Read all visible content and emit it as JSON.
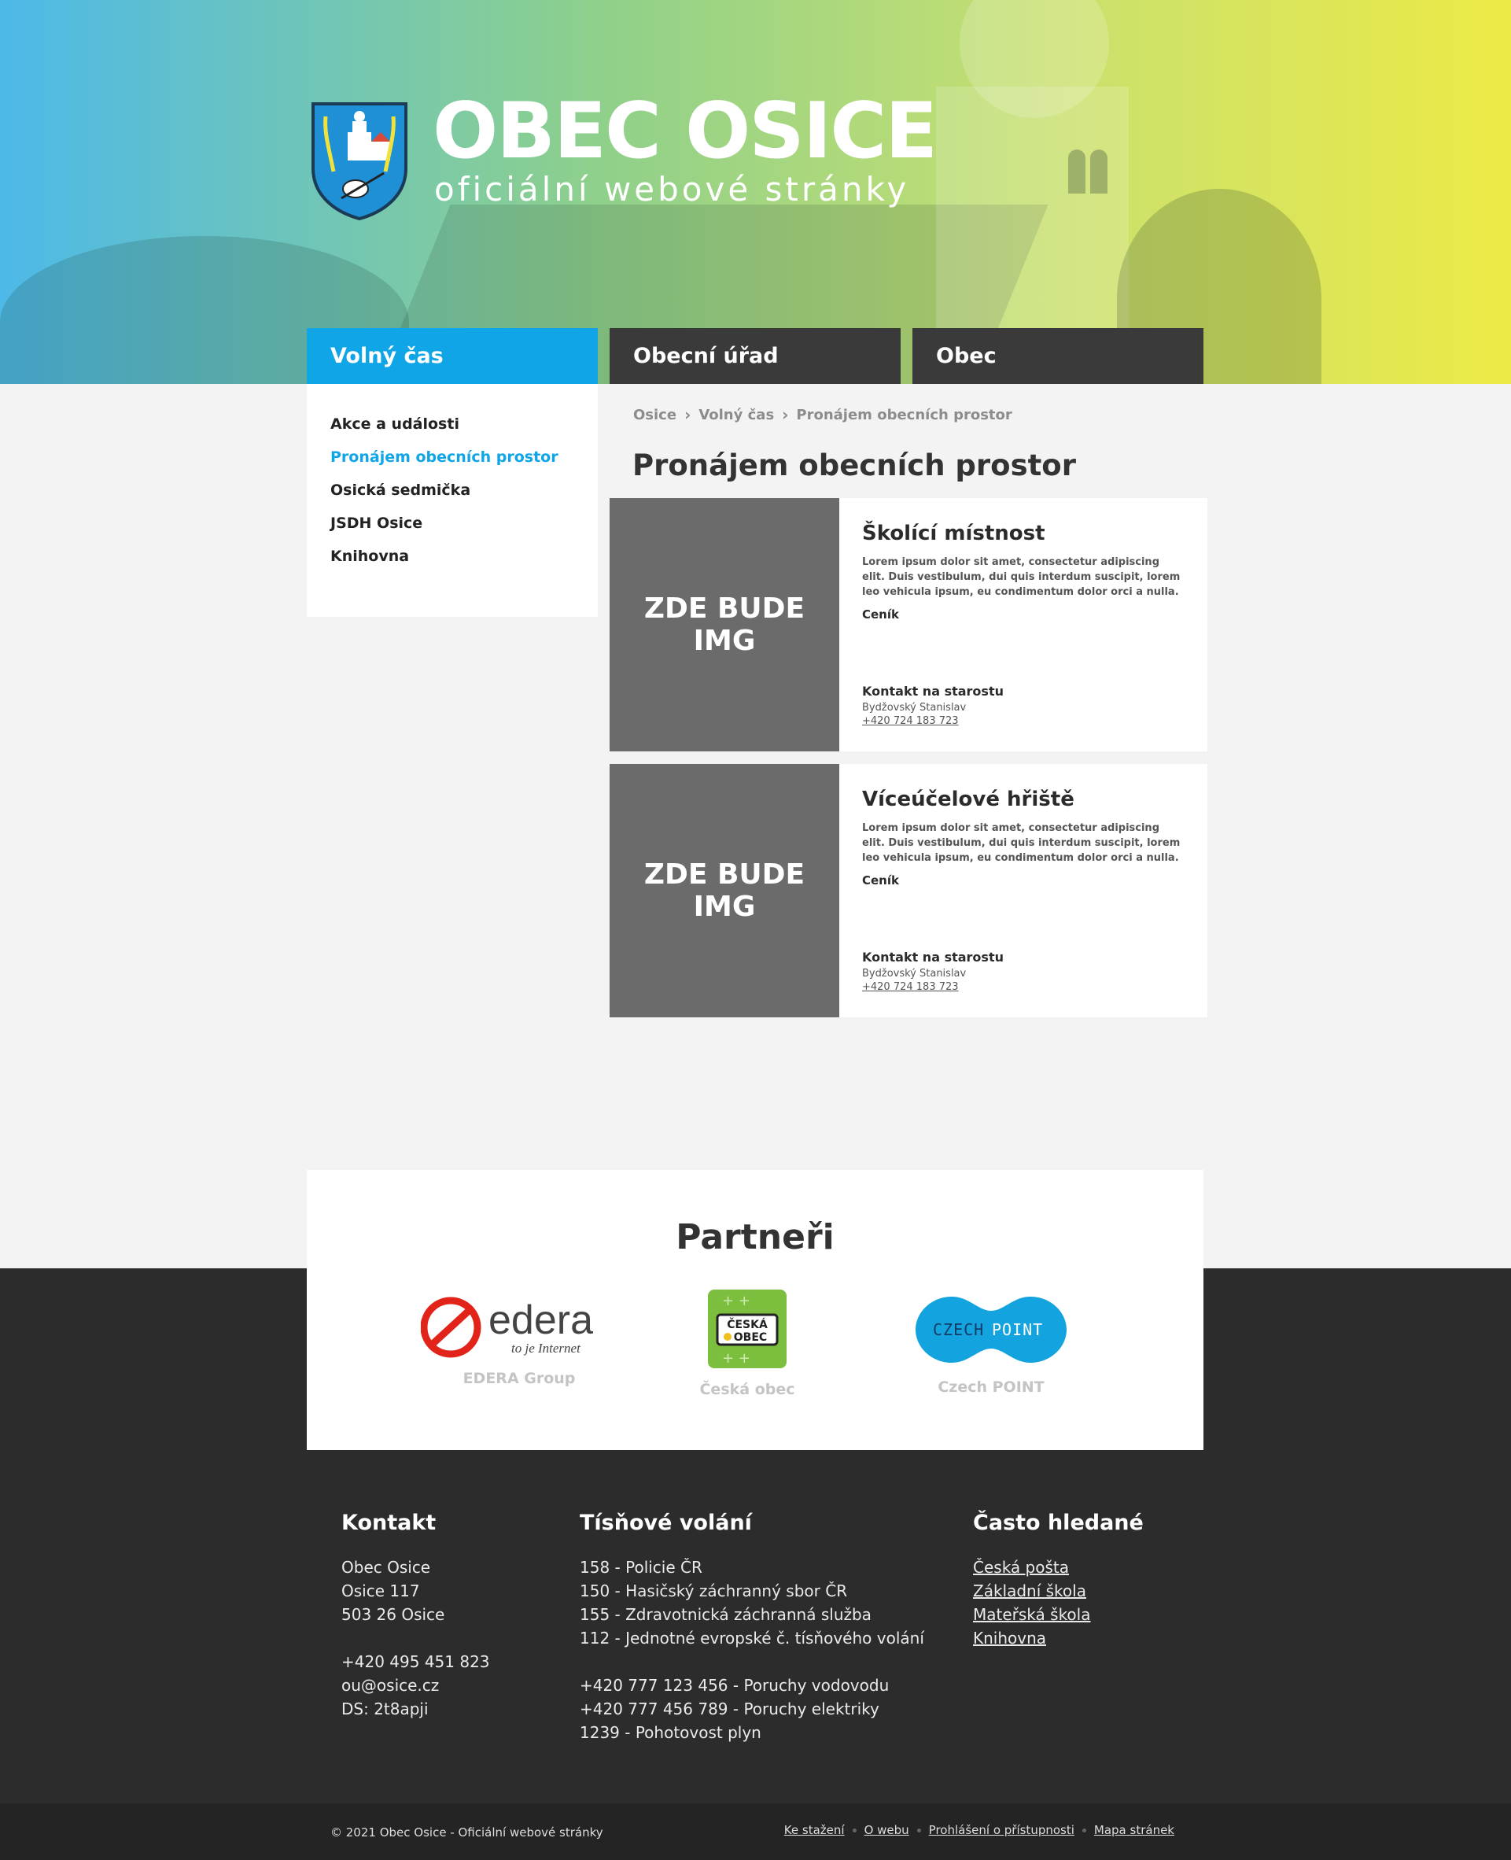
{
  "header": {
    "title": "OBEC OSICE",
    "subtitle": "oficiální webové stránky"
  },
  "nav": {
    "volny_cas": "Volný čas",
    "obecni_urad": "Obecní úřad",
    "obec": "Obec"
  },
  "sidebar": {
    "items": [
      {
        "label": "Akce a události"
      },
      {
        "label": "Pronájem obecních prostor"
      },
      {
        "label": "Osická sedmička"
      },
      {
        "label": "JSDH Osice"
      },
      {
        "label": "Knihovna"
      }
    ]
  },
  "breadcrumb": [
    "Osice",
    "Volný čas",
    "Pronájem obecních prostor"
  ],
  "page_title": "Pronájem obecních prostor",
  "cards": [
    {
      "image_placeholder": "ZDE BUDE IMG",
      "title": "Školící místnost",
      "description": "Lorem ipsum dolor sit amet, consectetur adipiscing elit. Duis vestibulum, dui quis interdum suscipit, lorem leo vehicula ipsum, eu condimentum dolor orci a nulla.",
      "price_label": "Ceník",
      "contact_label": "Kontakt na starostu",
      "contact_name": "Bydžovský Stanislav",
      "contact_phone": "+420 724 183 723"
    },
    {
      "image_placeholder": "ZDE BUDE IMG",
      "title": "Víceúčelové hřiště",
      "description": "Lorem ipsum dolor sit amet, consectetur adipiscing elit. Duis vestibulum, dui quis interdum suscipit, lorem leo vehicula ipsum, eu condimentum dolor orci a nulla.",
      "price_label": "Ceník",
      "contact_label": "Kontakt na starostu",
      "contact_name": "Bydžovský Stanislav",
      "contact_phone": "+420 724 183 723"
    }
  ],
  "partners": {
    "title": "Partneři",
    "items": [
      {
        "name": "EDERA Group",
        "logo_text": "edera",
        "logo_tagline": "to je Internet"
      },
      {
        "name": "Česká obec",
        "logo_text_1": "ČESKÁ",
        "logo_text_2": "OBEC"
      },
      {
        "name": "Czech POINT",
        "logo_text_1": "CZECH",
        "logo_text_2": "POINT"
      }
    ]
  },
  "footer": {
    "kontakt": {
      "title": "Kontakt",
      "lines": [
        "Obec Osice",
        "Osice 117",
        "503 26 Osice",
        "",
        "+420 495 451 823",
        "ou@osice.cz",
        "DS: 2t8apji"
      ]
    },
    "tisnove": {
      "title": "Tísňové volání",
      "lines": [
        "158 - Policie ČR",
        "150 - Hasičský záchranný sbor ČR",
        "155 - Zdravotnická záchranná služba",
        "112 - Jednotné evropské č. tísňového volání",
        "",
        "+420 777 123 456 - Poruchy vodovodu",
        "+420 777 456 789 - Poruchy elektriky",
        "1239 - Pohotovost plyn"
      ]
    },
    "casto": {
      "title": "Často hledané",
      "links": [
        "Česká pošta",
        "Základní škola",
        "Mateřská škola",
        "Knihovna"
      ]
    }
  },
  "bottom": {
    "copyright": "© 2021 Obec Osice - Oficiální webové stránky",
    "links": [
      "Ke stažení",
      "O webu",
      "Prohlášení o přístupnosti",
      "Mapa stránek"
    ]
  },
  "colors": {
    "accent": "#0fa5e6",
    "dark": "#3a3a3a",
    "footer": "#2c2c2c"
  }
}
